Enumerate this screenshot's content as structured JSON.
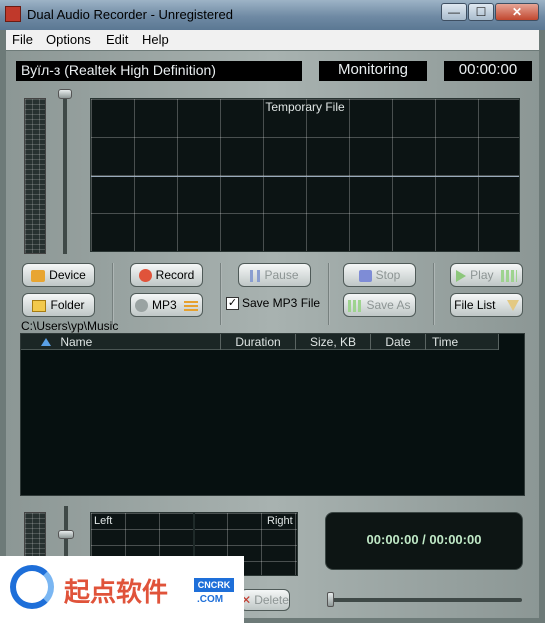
{
  "window": {
    "title": "Dual Audio Recorder - Unregistered",
    "min": "—",
    "max": "☐",
    "close": "✕"
  },
  "menu": [
    "File",
    "Options",
    "Edit",
    "Help"
  ],
  "device_name": "Вуїл-з (Realtek High Definition)",
  "status": "Monitoring",
  "timer": "00:00:00",
  "scope_title": "Temporary File",
  "buttons": {
    "device": "Device",
    "record": "Record",
    "pause": "Pause",
    "stop": "Stop",
    "play": "Play",
    "folder": "Folder",
    "mp3": "MP3",
    "save_mp3": "Save MP3 File",
    "save_as": "Save As",
    "file_list": "File List",
    "delete": "Delete"
  },
  "save_mp3_checked": true,
  "path": "C:\\Users\\yp\\Music",
  "list_columns": [
    "Name",
    "Duration",
    "Size, KB",
    "Date",
    "Time"
  ],
  "bottom_scope": {
    "left": "Left",
    "right": "Right"
  },
  "playback_time": "00:00:00 / 00:00:00",
  "watermark": {
    "text": "起点软件",
    "badge": "CNCRK",
    "domain": ".COM"
  },
  "colors": {
    "accent_record": "#e0533a",
    "play_green": "#6cc34a"
  }
}
